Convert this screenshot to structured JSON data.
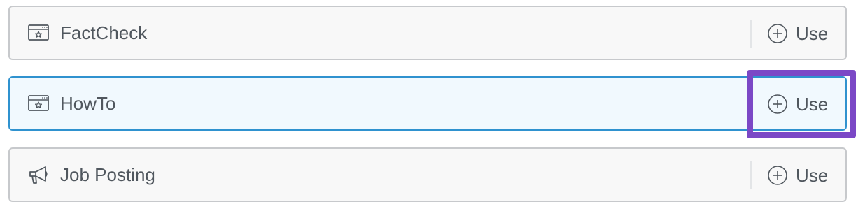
{
  "schema_types": [
    {
      "label": "FactCheck",
      "icon": "schema-window-star-icon",
      "action_label": "Use",
      "state": "default"
    },
    {
      "label": "HowTo",
      "icon": "schema-window-star-icon",
      "action_label": "Use",
      "state": "active"
    },
    {
      "label": "Job Posting",
      "icon": "megaphone-icon",
      "action_label": "Use",
      "state": "default"
    }
  ],
  "colors": {
    "border_default": "#c7c9cc",
    "border_active": "#2f92cf",
    "background_default": "#f8f8f8",
    "background_active": "#f1f9fe",
    "text": "#50575e",
    "highlight": "#7b48c6"
  }
}
